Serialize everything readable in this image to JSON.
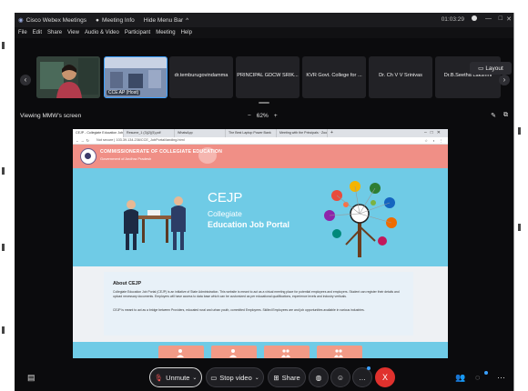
{
  "window": {
    "title": "Cisco Webex Meetings",
    "meeting_info": "Meeting Info",
    "hide_menu": "Hide Menu Bar",
    "timer": "01:03:29"
  },
  "menu": [
    "File",
    "Edit",
    "Share",
    "View",
    "Audio & Video",
    "Participant",
    "Meeting",
    "Help"
  ],
  "participants": [
    {
      "name": "",
      "kind": "video"
    },
    {
      "name": "CCE AP (Host)",
      "kind": "video-host"
    },
    {
      "name": "dr.temburugovindamma",
      "kind": "name"
    },
    {
      "name": "PRINCIPAL GDCW SRIK...",
      "kind": "name"
    },
    {
      "name": "KVR Govt. College for ...",
      "kind": "name"
    },
    {
      "name": "Dr. Ch V V Srinivas",
      "kind": "name"
    },
    {
      "name": "Dr.B.Seetha Lakshmi",
      "kind": "name"
    }
  ],
  "layout_label": "Layout",
  "share": {
    "viewing": "Viewing MMW's screen",
    "zoom_minus": "−",
    "zoom_level": "62%",
    "zoom_plus": "+"
  },
  "browser": {
    "tabs": [
      "CEJP - Collegiate Education Job",
      "Resume_1 (3)(2)(5).pdf",
      "WhatsApp",
      "The Best Laptop Power Bank",
      "Meeting with the Principals · Zoom"
    ],
    "url": "Not secure | 103.39.134.236/CCE_JobPortal/landing.html"
  },
  "site": {
    "header_title": "COMMISSIONERATE OF COLLEGIATE EDUCATION",
    "header_sub": "Government of Andhra Pradesh",
    "hero_title": "CEJP",
    "hero_line1": "Collegiate",
    "hero_line2": "Education Job Portal",
    "about_title": "About CEJP",
    "about_p1": "Collegiate Education Job Portal (CEJP) is an initiative of State Administration. This website is meant to act as a virtual meeting place for potential employees and employers. Student can register their details and upload necessary documents. Employers will have access to data base which can be customized as per educational qualifications, experience levels and industry verticals.",
    "about_p2": "CEJP is meant to act as a bridge between Providers, educated rural and urban youth, committed Employees. Skilled Employees are and job opportunities available in various industries.",
    "cards": [
      "Student Registration",
      "Student Login",
      "Employer Registration",
      "Employer Login"
    ]
  },
  "controls": {
    "unmute": "Unmute",
    "stop_video": "Stop video",
    "share": "Share",
    "leave": "X"
  },
  "colors": {
    "webex_bg": "#0b0b0d",
    "site_header": "#f08f86",
    "hero_bg": "#6fcbe6",
    "leave_red": "#e0312d",
    "accent_blue": "#3aa0ff"
  }
}
